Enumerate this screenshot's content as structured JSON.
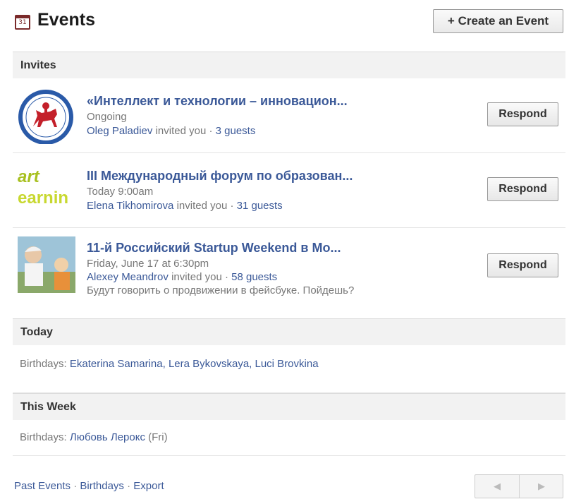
{
  "header": {
    "calendar_icon_day": "31",
    "title": "Events",
    "create_button": "+ Create an Event"
  },
  "sections": {
    "invites": "Invites",
    "today": "Today",
    "this_week": "This Week"
  },
  "invites": [
    {
      "title": "«Интеллект и технологии – инновацион...",
      "when": "Ongoing",
      "inviter": "Oleg Paladiev",
      "invited_text": " invited you · ",
      "guests": "3 guests",
      "respond": "Respond"
    },
    {
      "title": "III Международный форум по образован...",
      "when": "Today 9:00am",
      "inviter": "Elena Tikhomirova",
      "invited_text": " invited you · ",
      "guests": "31 guests",
      "respond": "Respond",
      "thumb_text_top": "art",
      "thumb_text_bottom": "earnin"
    },
    {
      "title": "11-й Российский Startup Weekend в Мо...",
      "when": "Friday, June 17 at 6:30pm",
      "inviter": "Alexey Meandrov",
      "invited_text": " invited you · ",
      "guests": "58 guests",
      "message": "Будут говорить о продвижении в фейсбуке. Пойдешь?",
      "respond": "Respond"
    }
  ],
  "today": {
    "label": "Birthdays: ",
    "names": "Ekaterina Samarina, Lera Bykovskaya, Luci Brovkina"
  },
  "this_week": {
    "label": "Birthdays: ",
    "name": "Любовь Лерокс",
    "suffix": " (Fri)"
  },
  "footer": {
    "past_events": "Past Events",
    "birthdays": "Birthdays",
    "export": "Export",
    "sep": " · "
  },
  "pager": {
    "prev": "◀",
    "next": "▶"
  },
  "colors": {
    "link": "#3b5998",
    "muted": "#777777",
    "section_bg": "#f2f2f2"
  }
}
